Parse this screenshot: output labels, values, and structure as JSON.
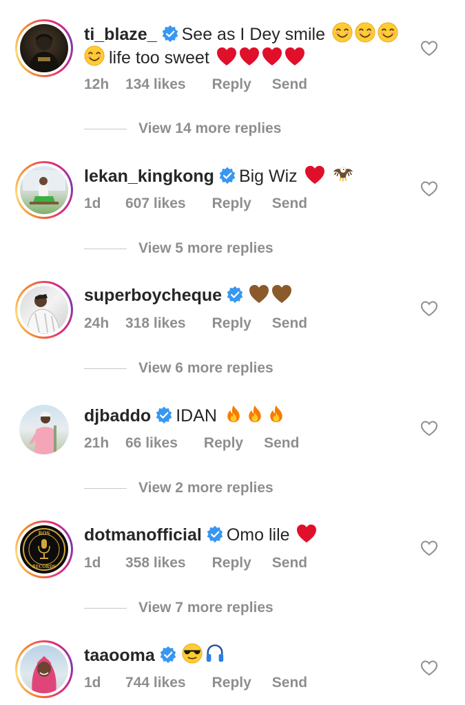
{
  "comments": [
    {
      "username": "ti_blaze_",
      "text_line1": "See as I Dey smile",
      "text_line2": "life too sweet",
      "time": "12h",
      "likes": "134 likes",
      "reply": "Reply",
      "send": "Send",
      "view_replies": "View 14 more replies",
      "emoji_names": [
        "smiling-face-icon",
        "smiling-face-icon",
        "smiling-face-icon",
        "smiling-face-icon",
        "red-heart-icon",
        "red-heart-icon",
        "red-heart-icon",
        "red-heart-icon"
      ]
    },
    {
      "username": "lekan_kingkong",
      "text_line1": "Big Wiz",
      "time": "1d",
      "likes": "607 likes",
      "reply": "Reply",
      "send": "Send",
      "view_replies": "View 5 more replies",
      "emoji_names": [
        "red-heart-icon",
        "eagle-icon"
      ]
    },
    {
      "username": "superboycheque",
      "text_line1": "",
      "time": "24h",
      "likes": "318 likes",
      "reply": "Reply",
      "send": "Send",
      "view_replies": "View 6 more replies",
      "emoji_names": [
        "brown-heart-icon",
        "brown-heart-icon"
      ]
    },
    {
      "username": "djbaddo",
      "text_line1": "IDAN",
      "time": "21h",
      "likes": "66 likes",
      "reply": "Reply",
      "send": "Send",
      "view_replies": "View 2 more replies",
      "emoji_names": [
        "fire-icon",
        "fire-icon",
        "fire-icon"
      ]
    },
    {
      "username": "dotmanofficial",
      "text_line1": "Omo lile",
      "time": "1d",
      "likes": "358 likes",
      "reply": "Reply",
      "send": "Send",
      "view_replies": "View 7 more replies",
      "emoji_names": [
        "red-heart-icon"
      ]
    },
    {
      "username": "taaooma",
      "text_line1": "",
      "time": "1d",
      "likes": "744 likes",
      "reply": "Reply",
      "send": "Send",
      "emoji_names": [
        "sunglasses-face-icon",
        "headphones-icon"
      ]
    }
  ],
  "colors": {
    "verified_badge": "#3897f0",
    "heart_red": "#e0102a",
    "meta_gray": "#8e8e8e",
    "brown_heart": "#8b5a2b"
  },
  "logo_text": {
    "avatar5_top": "ROS",
    "avatar5_bottom": "RECORDS"
  }
}
